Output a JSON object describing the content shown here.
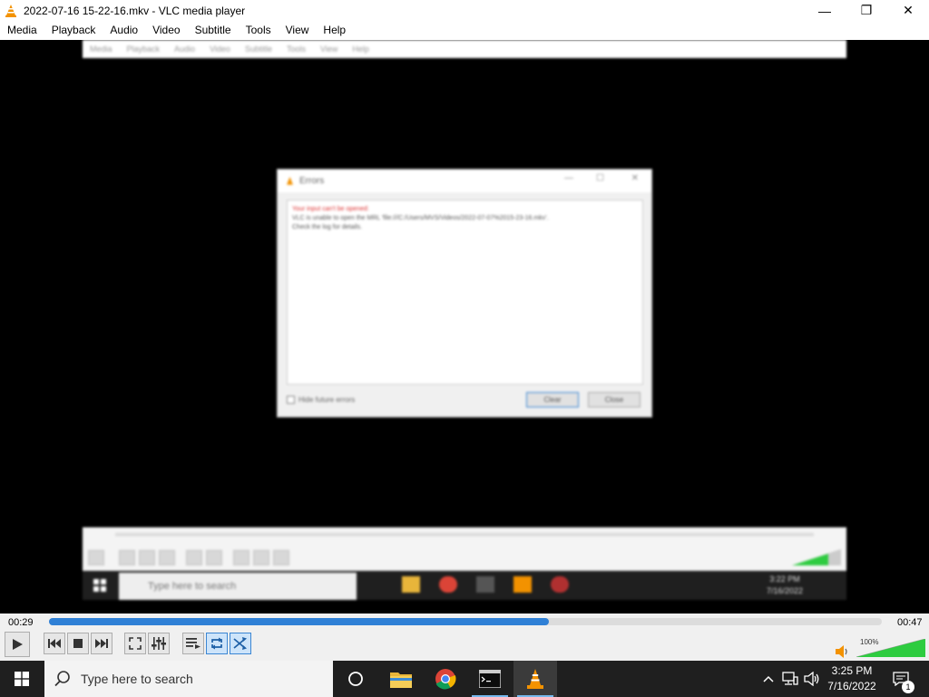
{
  "window": {
    "title": "2022-07-16 15-22-16.mkv - VLC media player",
    "minimize_symbol": "—",
    "maximize_symbol": "❐",
    "close_symbol": "✕"
  },
  "menu": [
    {
      "label": "Media"
    },
    {
      "label": "Playback"
    },
    {
      "label": "Audio"
    },
    {
      "label": "Video"
    },
    {
      "label": "Subtitle"
    },
    {
      "label": "Tools"
    },
    {
      "label": "View"
    },
    {
      "label": "Help"
    }
  ],
  "video_frame": {
    "menu": [
      "Media",
      "Playback",
      "Audio",
      "Video",
      "Subtitle",
      "Tools",
      "View",
      "Help"
    ],
    "dialog": {
      "title": "Errors",
      "line1": "Your input can't be opened:",
      "line2": "VLC is unable to open the MRL 'file:///C:/Users/MVS/Videos/2022-07-07%2015-23-16.mkv'.",
      "line3": "Check the log for details.",
      "checkbox_label": "Hide future errors",
      "clear_label": "Clear",
      "close_label": "Close"
    },
    "taskbar": {
      "search_placeholder": "Type here to search",
      "time": "3:22 PM",
      "date": "7/16/2022"
    }
  },
  "player": {
    "elapsed": "00:29",
    "total": "00:47",
    "progress_fraction": 0.6,
    "volume_label": "100%",
    "volume_fraction": 1.0,
    "accent_color": "#2f80d6"
  },
  "taskbar": {
    "search_placeholder": "Type here to search",
    "time": "3:25 PM",
    "date": "7/16/2022",
    "notification_count": "1"
  }
}
